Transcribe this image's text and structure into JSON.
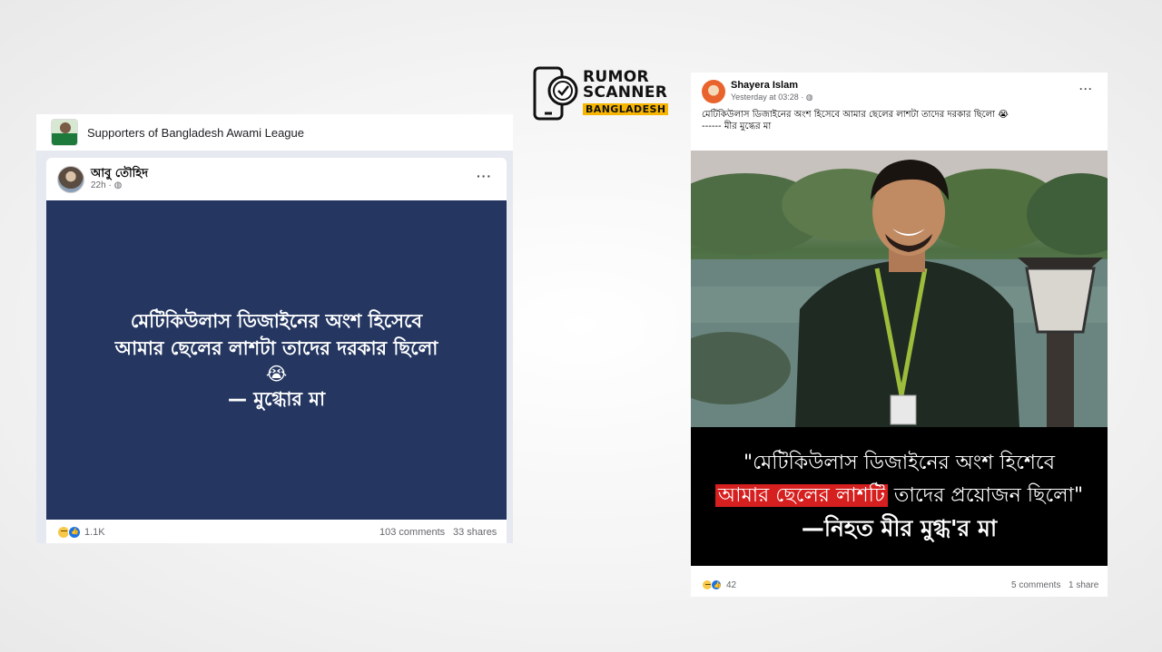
{
  "logo": {
    "line1": "RUMOR",
    "line2": "SCANNER",
    "badge": "BANGLADESH",
    "icon": "phone-check-icon"
  },
  "left_post": {
    "group_name": "Supporters of Bangladesh Awami League",
    "author": "আবু তৌহিদ",
    "time": "22h · ",
    "menu": "···",
    "banner": {
      "line1": "মেটিকিউলাস ডিজাইনের অংশ হিসেবে",
      "line2": "আমার ছেলের লাশটা তাদের দরকার ছিলো",
      "emoji": "😭",
      "line3": "— মুগ্ধোর মা",
      "bg_color": "#253761"
    },
    "reactions_count": "1.1K",
    "comments": "103 comments",
    "shares": "33 shares"
  },
  "right_post": {
    "author": "Shayera Islam",
    "time": "Yesterday at 03:28 · ",
    "menu": "···",
    "text_line1": "মেটিকিউলাস ডিজাইনের অংশ হিসেবে আমার ছেলের লাশটা তাদের দরকার ছিলো 😭",
    "text_line2": "------ মীর মুগ্ধের মা",
    "caption": {
      "line1": "\"মেটিকিউলাস ডিজাইনের অংশ হিশেবে",
      "line2_highlight": "আমার ছেলের লাশটি",
      "line2_rest": " তাদের প্রয়োজন ছিলো\"",
      "line3": "—নিহত মীর মুগ্ধ'র মা",
      "highlight_color": "#d61f1f"
    },
    "reactions_count": "42",
    "comments": "5 comments",
    "shares": "1 share"
  }
}
